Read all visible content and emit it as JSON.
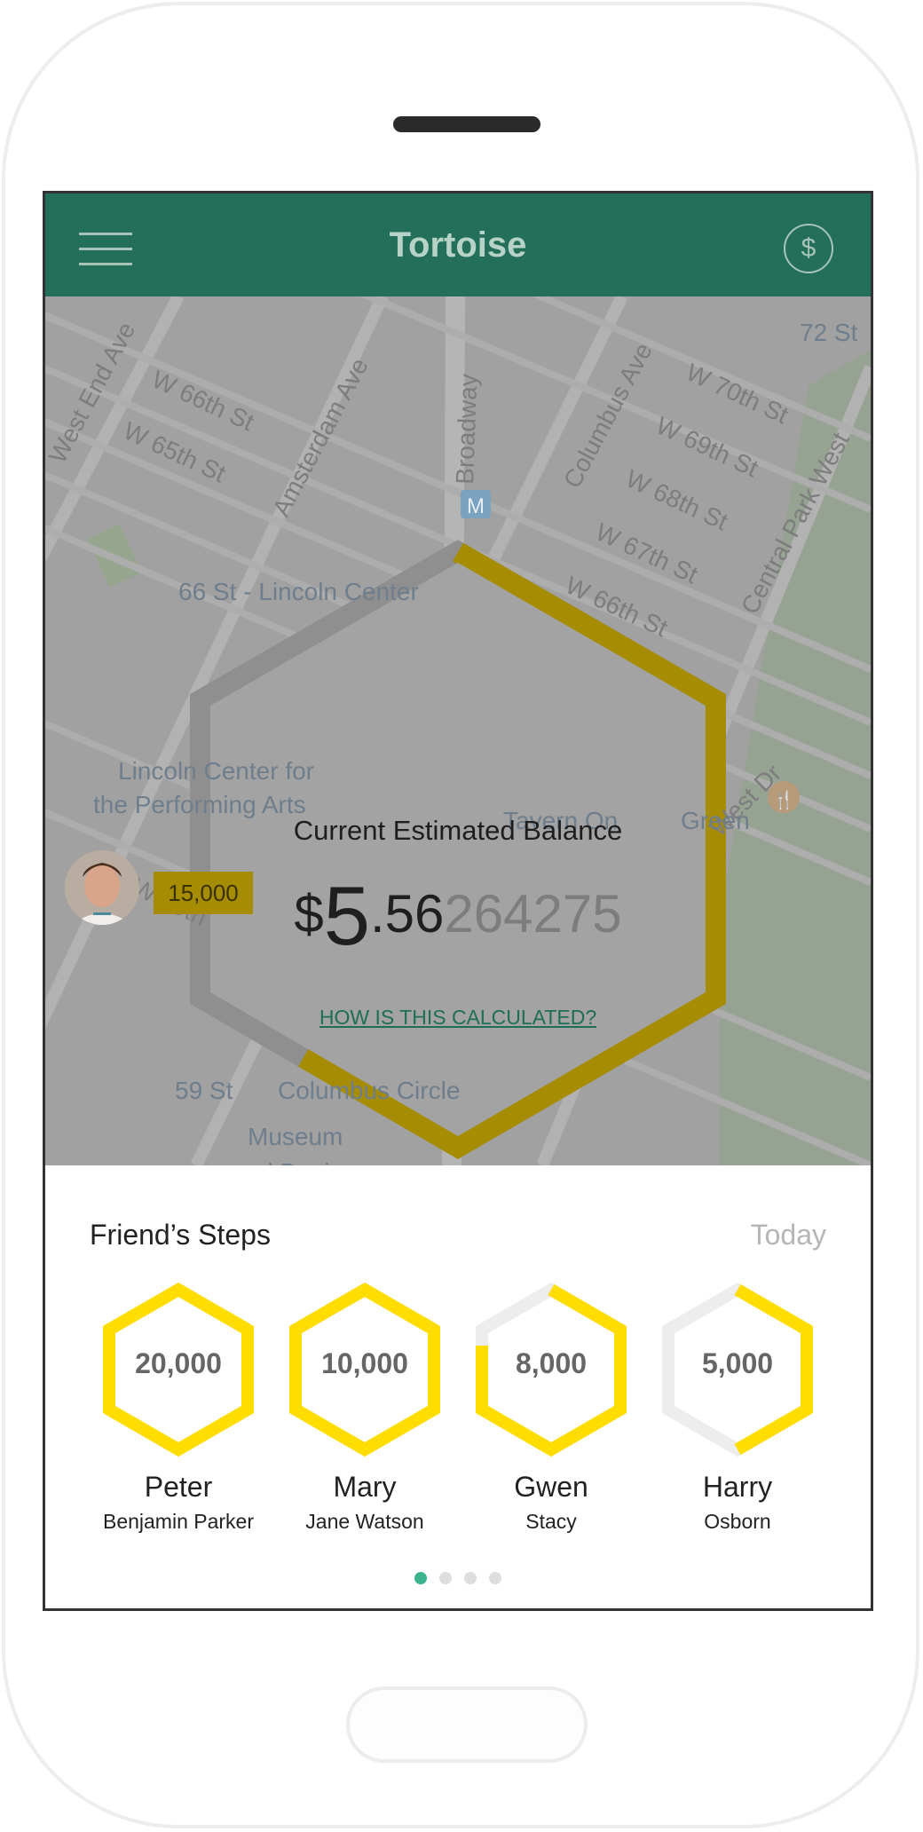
{
  "app": {
    "title": "Tortoise",
    "accent": "#236f59",
    "highlight": "#ffdd00"
  },
  "header": {
    "menu_icon": "hamburger-icon",
    "wallet_icon": "dollar-circle-icon",
    "wallet_symbol": "$"
  },
  "map": {
    "streets": [
      "West End Ave",
      "W 66th St",
      "W 65th St",
      "Amsterdam Ave",
      "Broadway",
      "Columbus Ave",
      "W 70th St",
      "W 69th St",
      "W 68th St",
      "W 67th St",
      "W 66th St",
      "Central Park West",
      "72 St",
      "West Dr",
      "W 59th"
    ],
    "places": [
      "66 St - Lincoln Center",
      "Lincoln Center for",
      "the Performing Arts",
      "Tavern On",
      "Green",
      "59 St",
      "Columbus Circle",
      "Museum",
      "and Design"
    ],
    "transit_badge": "M",
    "restaurant_icon": "utensils-icon"
  },
  "balance": {
    "label": "Current Estimated Balance",
    "currency": "$",
    "whole": "5",
    "cents": ".56",
    "fraction": "264275",
    "progress": 0.6,
    "help_link": "HOW IS THIS CALCULATED?"
  },
  "user": {
    "steps": "15,000",
    "avatar_icon": "user-avatar"
  },
  "friends_panel": {
    "title": "Friend’s Steps",
    "range": "Today",
    "friends": [
      {
        "first": "Peter",
        "last": "Benjamin Parker",
        "steps": "20,000",
        "progress": 1.0
      },
      {
        "first": "Mary",
        "last": "Jane Watson",
        "steps": "10,000",
        "progress": 1.0
      },
      {
        "first": "Gwen",
        "last": "Stacy",
        "steps": "8,000",
        "progress": 0.8
      },
      {
        "first": "Harry",
        "last": "Osborn",
        "steps": "5,000",
        "progress": 0.5
      }
    ],
    "page_count": 4,
    "active_page": 0
  }
}
